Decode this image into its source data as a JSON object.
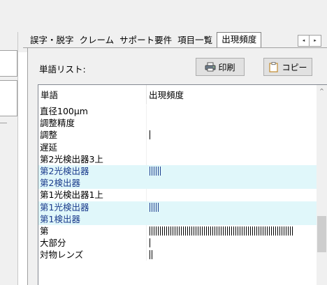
{
  "tabs": [
    {
      "label": "誤字・脱字",
      "active": false
    },
    {
      "label": "クレーム",
      "active": false
    },
    {
      "label": "サポート要件",
      "active": false
    },
    {
      "label": "項目一覧",
      "active": false
    },
    {
      "label": "出現頻度",
      "active": true
    }
  ],
  "tab_scroll": {
    "left": "◂",
    "right": "▸"
  },
  "panel": {
    "word_list_label": "単語リスト:",
    "print_button": "印刷",
    "copy_button": "コピー"
  },
  "table": {
    "columns": [
      "単語",
      "出現頻度"
    ],
    "rows": [
      {
        "word": "直径100μm",
        "count": 0,
        "selected": false
      },
      {
        "word": "調整精度",
        "count": 0,
        "selected": false
      },
      {
        "word": "調整",
        "count": 1,
        "selected": false
      },
      {
        "word": "遅延",
        "count": 0,
        "selected": false
      },
      {
        "word": "第2光検出器3上",
        "count": 0,
        "selected": false
      },
      {
        "word": "第2光検出器",
        "count": 6,
        "selected": true
      },
      {
        "word": "第2検出器",
        "count": 0,
        "selected": true
      },
      {
        "word": "第1光検出器1上",
        "count": 0,
        "selected": false
      },
      {
        "word": "第1光検出器",
        "count": 5,
        "selected": true
      },
      {
        "word": "第1検出器",
        "count": 0,
        "selected": true
      },
      {
        "word": "第",
        "count": 69,
        "selected": false
      },
      {
        "word": "大部分",
        "count": 1,
        "selected": false
      },
      {
        "word": "対物レンズ",
        "count": 2,
        "selected": false
      }
    ]
  },
  "colors": {
    "selection_bg": "#e0f7fa",
    "selection_text": "#1a3b8c",
    "chrome_bg": "#f0f0f0"
  },
  "icons": {
    "print": "printer-icon",
    "copy": "clipboard-icon",
    "sort": "sort-up-icon"
  }
}
